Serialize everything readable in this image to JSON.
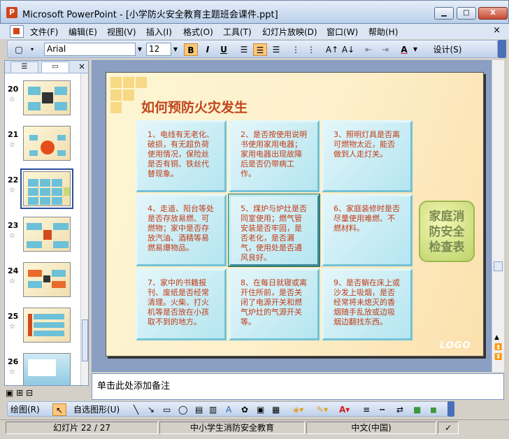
{
  "window": {
    "title": "Microsoft PowerPoint - [小学防火安全教育主题班会课件.ppt]",
    "minimize": "▁",
    "maximize": "□",
    "close": "X"
  },
  "menu": {
    "items": [
      "文件(F)",
      "编辑(E)",
      "视图(V)",
      "插入(I)",
      "格式(O)",
      "工具(T)",
      "幻灯片放映(D)",
      "窗口(W)",
      "帮助(H)"
    ],
    "close": "×"
  },
  "toolbar": {
    "font": "Arial",
    "size": "12",
    "bold": "B",
    "italic": "I",
    "underline": "U",
    "font_color": "A",
    "design": "设计(S)"
  },
  "left_pane": {
    "tab_outline": "☰",
    "tab_slides": "▭",
    "close": "×",
    "slides": [
      {
        "num": "20",
        "star": "☆"
      },
      {
        "num": "21",
        "star": "☆"
      },
      {
        "num": "22",
        "star": "☆"
      },
      {
        "num": "23",
        "star": "☆"
      },
      {
        "num": "24",
        "star": "☆"
      },
      {
        "num": "25",
        "star": "☆"
      },
      {
        "num": "26",
        "star": "☆"
      }
    ]
  },
  "slide": {
    "title": "如何预防火灾发生",
    "cells": [
      "1、电线有无老化、破损，有无超负荷使用情况，保险丝是否有铜、铁丝代替现象。",
      "2、是否按使用说明书使用家用电器；家用电器出现故障后是否仍带病工作。",
      "3、照明灯具是否离可燃物太近，能否做到人走灯关。",
      "4、走道、阳台等处是否存放易燃、可燃物；家中是否存放汽油、酒精等易燃易爆物品。",
      "5、煤炉与炉灶是否同室使用；燃气管安装是否牢固，是否老化，是否漏气，使用处是否通风良好。",
      "6、家庭装修时是否尽量使用难燃、不燃材料。",
      "7、家中的书籍报刊、废纸是否经常清理。火柴、打火机等是否放在小孩取不到的地方。",
      "8、在每日就寝或离开住所前，是否关闭了电源开关和燃气炉灶的气源开关等。",
      "9、是否躺在床上或沙发上吸烟，是否经常将未熄灭的香烟随手乱放或边吸烟边翻找东西。"
    ],
    "side_box": "家庭消防安全检查表",
    "logo": "LOGO"
  },
  "notes": {
    "placeholder": "单击此处添加备注"
  },
  "drawbar": {
    "draw": "绘图(R)",
    "autoshapes": "自选图形(U)"
  },
  "statusbar": {
    "slide_info": "幻灯片 22 / 27",
    "template": "中小学生消防安全教育",
    "language": "中文(中国)"
  },
  "colors": {
    "title_red": "#c1451e",
    "cell_text": "#c23b16",
    "cell_bg": "#b4e5f0",
    "side_box_bg": "#d8e58c"
  }
}
